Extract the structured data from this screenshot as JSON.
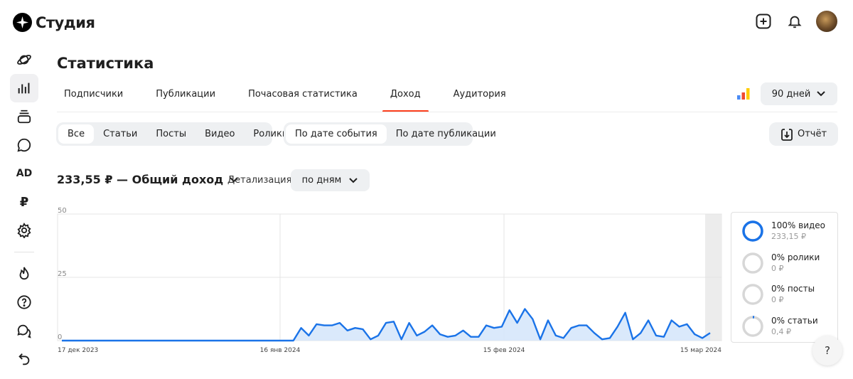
{
  "app": {
    "logo_text": "Студия"
  },
  "page": {
    "title": "Статистика"
  },
  "tabs": [
    {
      "label": "Подписчики",
      "active": false
    },
    {
      "label": "Публикации",
      "active": false
    },
    {
      "label": "Почасовая статистика",
      "active": false
    },
    {
      "label": "Доход",
      "active": true
    },
    {
      "label": "Аудитория",
      "active": false
    }
  ],
  "period": {
    "label": "90 дней"
  },
  "content_filter": [
    {
      "label": "Все",
      "active": true
    },
    {
      "label": "Статьи",
      "active": false
    },
    {
      "label": "Посты",
      "active": false
    },
    {
      "label": "Видео",
      "active": false
    },
    {
      "label": "Ролики",
      "active": false
    }
  ],
  "date_filter": [
    {
      "label": "По дате события",
      "active": true
    },
    {
      "label": "По дате публикации",
      "active": false
    }
  ],
  "report": {
    "label": "Отчёт"
  },
  "income": {
    "label": "233,55 ₽ — Общий доход"
  },
  "detail": {
    "label": "Детализация",
    "value": "по дням"
  },
  "legend": [
    {
      "label": "100% видео",
      "value": "233,15 ₽",
      "fraction": 1.0
    },
    {
      "label": "0% ролики",
      "value": "0 ₽",
      "fraction": 0
    },
    {
      "label": "0% посты",
      "value": "0 ₽",
      "fraction": 0
    },
    {
      "label": "0% статьи",
      "value": "0,4 ₽",
      "fraction": 0.0017
    }
  ],
  "help": {
    "label": "?"
  },
  "colors": {
    "accent": "#fc3f1d",
    "series": "#1a73e8",
    "fill": "#d6e7fb"
  },
  "chart_data": {
    "type": "area",
    "xlabel": "",
    "ylabel": "",
    "ylim": [
      0,
      50
    ],
    "y_ticks": [
      "50",
      "25",
      "0"
    ],
    "x_tick_labels": [
      "17 дек 2023",
      "16 янв 2024",
      "15 фев 2024",
      "15 мар 2024"
    ],
    "grid": true,
    "series": [
      {
        "values": [
          0,
          0,
          0,
          0,
          0,
          0,
          0,
          0,
          0,
          0,
          0,
          0,
          0,
          0,
          0,
          0,
          0,
          0,
          0,
          0,
          0,
          0,
          0,
          0,
          0,
          0,
          0,
          0,
          0,
          0,
          0,
          5,
          2,
          6.5,
          6,
          6,
          7,
          4,
          5,
          4.5,
          0.5,
          2,
          7,
          7.5,
          0.5,
          7,
          2,
          3.5,
          6,
          2.5,
          1.5,
          2,
          4,
          1.5,
          1.5,
          6,
          5,
          5.5,
          12,
          7,
          12.5,
          8.5,
          0.5,
          8,
          2,
          1,
          5,
          6,
          6,
          3,
          0.5,
          1,
          5.5,
          11,
          0.5,
          3,
          8,
          2,
          1.5,
          8,
          5.5,
          6.5,
          2.5,
          1,
          3
        ]
      }
    ]
  }
}
